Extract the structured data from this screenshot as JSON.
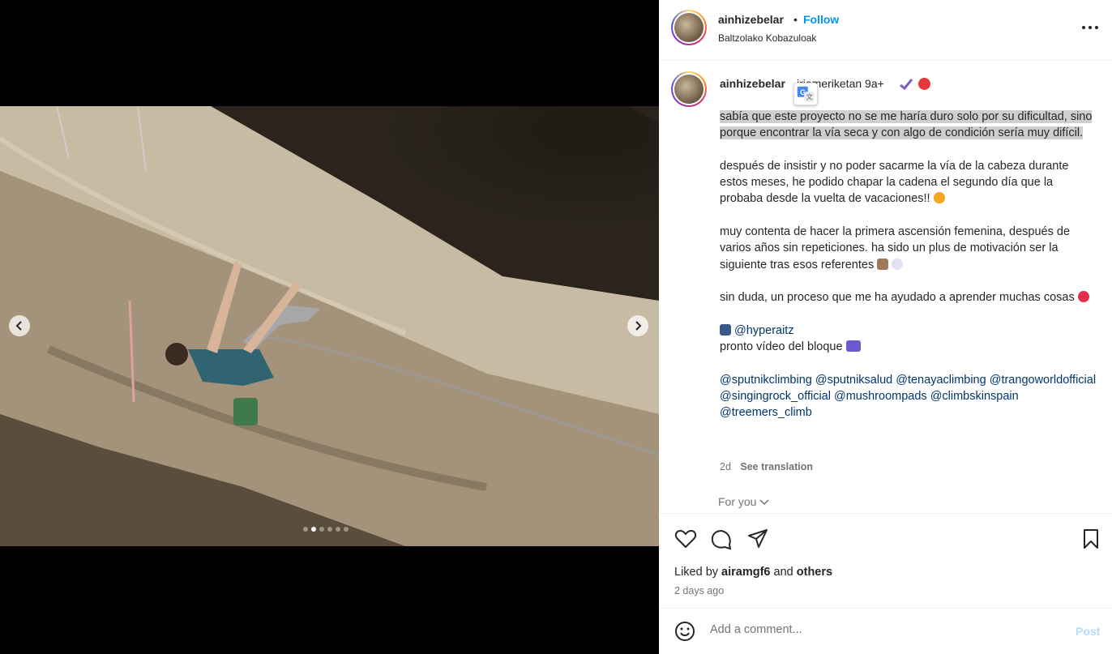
{
  "post": {
    "username": "ainhizebelar",
    "separator": "•",
    "follow_label": "Follow",
    "location": "Baltzolako Kobazuloak",
    "more_icon": "more-horizontal-icon"
  },
  "media": {
    "prev_icon": "chevron-left-icon",
    "next_icon": "chevron-right-icon",
    "carousel_dots": 6,
    "active_dot": 2
  },
  "caption": {
    "username": "ainhizebelar",
    "title": "iriemeriketan 9a+",
    "paragraph1": "sabía que este proyecto no se me haría duro solo por su dificultad, sino porque encontrar la vía seca y con algo de condición sería muy difícil.",
    "paragraph2": "después de insistir y no poder sacarme la vía de la cabeza durante estos meses, he podido chapar la cadena el segundo día que la probaba desde la vuelta de vacaciones!!",
    "paragraph3": "muy contenta de hacer la primera ascensión femenina, después de varios años sin repeticiones. ha sido un plus de motivación ser la siguiente tras esos referentes",
    "paragraph4": "sin duda, un proceso que me ha ayudado a aprender muchas cosas",
    "video_tag": "@hyperaitz",
    "video_line": "pronto vídeo del bloque",
    "tags": [
      "@sputnikclimbing",
      "@sputniksalud",
      "@tenayaclimbing",
      "@trangoworldofficial",
      "@singingrock_official",
      "@mushroompads",
      "@climbskinspain",
      "@treemers_climb"
    ],
    "age": "2d",
    "see_translation": "See translation"
  },
  "for_you": "For you",
  "likes": {
    "prefix": "Liked by",
    "user": "airamgf6",
    "and": "and",
    "others": "others",
    "time": "2 days ago"
  },
  "comment_box": {
    "placeholder": "Add a comment...",
    "post_label": "Post"
  },
  "colors": {
    "follow": "#0095f6",
    "tag": "#00376b",
    "highlight": "#cfcfcf",
    "post_disabled": "#b3dbff"
  }
}
